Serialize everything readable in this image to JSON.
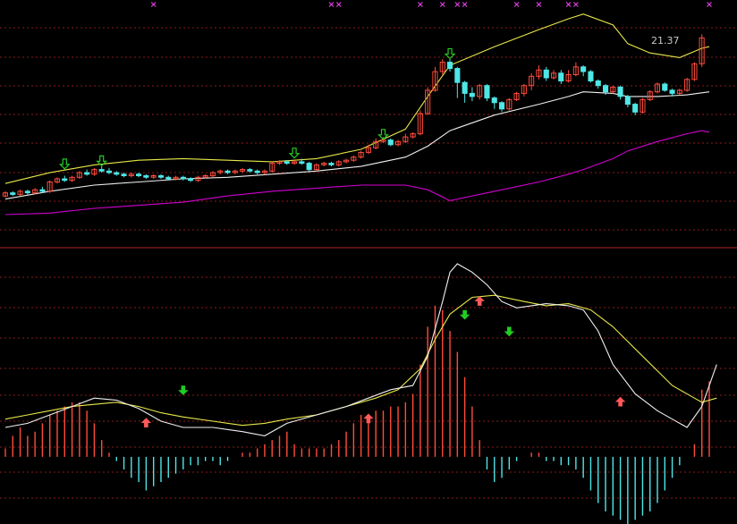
{
  "colors": {
    "background": "#000000",
    "grid": "#8b1a1a",
    "divider": "#b22222",
    "up_candle": "#ff4c3b",
    "down_candle": "#4fe6e6",
    "upper_band": "#e8e84a",
    "middle_band": "#f0f0f0",
    "lower_band": "#d000d0",
    "marker_x": "#e040e0",
    "signal_arrow": "#22cc22",
    "buy_arrow": "#ff5a5a",
    "macd_line": "#f0f0f0",
    "signal_line": "#e8e84a",
    "hist_pos": "#ff4c3b",
    "hist_neg": "#4fe6e6"
  },
  "chart_data": [
    {
      "type": "candlestick",
      "panel": "price",
      "price_label": "21.37",
      "ylim": [
        10,
        23
      ],
      "grid": true,
      "x_count": 96,
      "candles": [
        [
          0,
          11.2,
          11.4,
          11.5,
          11.1
        ],
        [
          1,
          11.4,
          11.3,
          11.5,
          11.2
        ],
        [
          2,
          11.3,
          11.5,
          11.6,
          11.2
        ],
        [
          3,
          11.5,
          11.4,
          11.6,
          11.3
        ],
        [
          4,
          11.4,
          11.6,
          11.7,
          11.3
        ],
        [
          5,
          11.6,
          11.5,
          11.8,
          11.4
        ],
        [
          6,
          11.5,
          12.1,
          12.2,
          11.4
        ],
        [
          7,
          12.1,
          12.3,
          12.4,
          12.0
        ],
        [
          8,
          12.3,
          12.2,
          12.5,
          12.1
        ],
        [
          9,
          12.2,
          12.4,
          12.5,
          12.1
        ],
        [
          10,
          12.4,
          12.7,
          12.8,
          12.3
        ],
        [
          11,
          12.7,
          12.6,
          12.9,
          12.5
        ],
        [
          12,
          12.6,
          12.9,
          13.0,
          12.5
        ],
        [
          13,
          12.9,
          12.8,
          13.1,
          12.7
        ],
        [
          14,
          12.8,
          12.7,
          13.0,
          12.6
        ],
        [
          15,
          12.7,
          12.6,
          12.8,
          12.5
        ],
        [
          16,
          12.6,
          12.5,
          12.7,
          12.4
        ],
        [
          17,
          12.5,
          12.6,
          12.7,
          12.4
        ],
        [
          18,
          12.6,
          12.5,
          12.7,
          12.4
        ],
        [
          19,
          12.5,
          12.4,
          12.6,
          12.3
        ],
        [
          20,
          12.4,
          12.5,
          12.6,
          12.3
        ],
        [
          21,
          12.5,
          12.4,
          12.6,
          12.3
        ],
        [
          22,
          12.4,
          12.3,
          12.5,
          12.2
        ],
        [
          23,
          12.3,
          12.4,
          12.5,
          12.2
        ],
        [
          24,
          12.4,
          12.3,
          12.5,
          12.2
        ],
        [
          25,
          12.3,
          12.2,
          12.4,
          12.1
        ],
        [
          26,
          12.2,
          12.4,
          12.5,
          12.1
        ],
        [
          27,
          12.4,
          12.5,
          12.6,
          12.3
        ],
        [
          28,
          12.5,
          12.7,
          12.8,
          12.4
        ],
        [
          29,
          12.7,
          12.8,
          12.9,
          12.6
        ],
        [
          30,
          12.8,
          12.7,
          12.9,
          12.6
        ],
        [
          31,
          12.7,
          12.8,
          12.9,
          12.6
        ],
        [
          32,
          12.8,
          12.9,
          13.0,
          12.7
        ],
        [
          33,
          12.9,
          12.8,
          13.0,
          12.7
        ],
        [
          34,
          12.8,
          12.7,
          12.9,
          12.6
        ],
        [
          35,
          12.7,
          12.8,
          12.9,
          12.6
        ],
        [
          36,
          12.8,
          13.3,
          13.4,
          12.7
        ],
        [
          37,
          13.3,
          13.4,
          13.5,
          13.2
        ],
        [
          38,
          13.4,
          13.3,
          13.5,
          13.2
        ],
        [
          39,
          13.3,
          13.4,
          13.5,
          13.2
        ],
        [
          40,
          13.4,
          13.3,
          13.6,
          13.2
        ],
        [
          41,
          13.3,
          12.9,
          13.4,
          12.8
        ],
        [
          42,
          12.9,
          13.2,
          13.3,
          12.8
        ],
        [
          43,
          13.2,
          13.3,
          13.4,
          13.1
        ],
        [
          44,
          13.3,
          13.2,
          13.4,
          13.1
        ],
        [
          45,
          13.2,
          13.4,
          13.5,
          13.1
        ],
        [
          46,
          13.4,
          13.5,
          13.6,
          13.3
        ],
        [
          47,
          13.5,
          13.7,
          13.8,
          13.4
        ],
        [
          48,
          13.7,
          14.0,
          14.1,
          13.6
        ],
        [
          49,
          14.0,
          14.3,
          14.5,
          13.9
        ],
        [
          50,
          14.3,
          14.7,
          14.9,
          14.2
        ],
        [
          51,
          14.7,
          14.8,
          15.0,
          14.6
        ],
        [
          52,
          14.8,
          14.5,
          14.9,
          14.4
        ],
        [
          53,
          14.5,
          14.7,
          14.8,
          14.4
        ],
        [
          54,
          14.7,
          15.0,
          15.2,
          14.6
        ],
        [
          55,
          15.0,
          15.2,
          15.3,
          14.9
        ],
        [
          56,
          15.2,
          16.5,
          16.7,
          15.1
        ],
        [
          57,
          16.5,
          18.0,
          18.2,
          16.4
        ],
        [
          58,
          18.0,
          19.2,
          19.5,
          17.9
        ],
        [
          59,
          19.2,
          19.8,
          20.0,
          19.0
        ],
        [
          60,
          19.8,
          19.4,
          20.0,
          19.2
        ],
        [
          61,
          19.4,
          18.5,
          19.5,
          17.5
        ],
        [
          62,
          18.5,
          17.8,
          18.6,
          17.2
        ],
        [
          63,
          17.8,
          17.6,
          18.2,
          17.3
        ],
        [
          64,
          17.6,
          18.3,
          18.4,
          17.4
        ],
        [
          65,
          18.3,
          17.5,
          18.4,
          17.3
        ],
        [
          66,
          17.5,
          17.2,
          17.6,
          16.8
        ],
        [
          67,
          17.2,
          16.8,
          17.3,
          16.6
        ],
        [
          68,
          16.8,
          17.4,
          17.5,
          16.7
        ],
        [
          69,
          17.4,
          17.8,
          17.9,
          17.3
        ],
        [
          70,
          17.8,
          18.3,
          18.4,
          17.6
        ],
        [
          71,
          18.3,
          18.9,
          19.1,
          18.0
        ],
        [
          72,
          18.9,
          19.3,
          19.6,
          18.7
        ],
        [
          73,
          19.3,
          18.8,
          19.5,
          18.6
        ],
        [
          74,
          18.8,
          19.1,
          19.3,
          18.7
        ],
        [
          75,
          19.1,
          18.6,
          19.3,
          18.4
        ],
        [
          76,
          18.6,
          19.0,
          19.3,
          18.5
        ],
        [
          77,
          19.0,
          19.5,
          19.8,
          18.9
        ],
        [
          78,
          19.5,
          19.2,
          19.6,
          18.9
        ],
        [
          79,
          19.2,
          18.6,
          19.3,
          18.5
        ],
        [
          80,
          18.6,
          18.3,
          18.7,
          18.1
        ],
        [
          81,
          18.3,
          17.9,
          18.4,
          17.7
        ],
        [
          82,
          17.9,
          18.2,
          18.3,
          17.8
        ],
        [
          83,
          18.2,
          17.6,
          18.3,
          17.4
        ],
        [
          84,
          17.6,
          17.1,
          17.7,
          16.9
        ],
        [
          85,
          17.1,
          16.6,
          17.2,
          16.4
        ],
        [
          86,
          16.6,
          17.4,
          17.5,
          16.5
        ],
        [
          87,
          17.4,
          17.9,
          18.0,
          17.3
        ],
        [
          88,
          17.9,
          18.4,
          18.5,
          17.8
        ],
        [
          89,
          18.4,
          18.0,
          18.5,
          17.9
        ],
        [
          90,
          18.0,
          17.8,
          18.1,
          17.6
        ],
        [
          91,
          17.8,
          18.0,
          18.1,
          17.7
        ],
        [
          92,
          18.0,
          18.7,
          18.8,
          17.9
        ],
        [
          93,
          18.7,
          19.7,
          19.8,
          18.6
        ],
        [
          94,
          19.7,
          21.37,
          21.6,
          19.5
        ]
      ],
      "upper_band": [
        [
          0,
          12.0
        ],
        [
          6,
          12.7
        ],
        [
          12,
          13.2
        ],
        [
          18,
          13.5
        ],
        [
          24,
          13.6
        ],
        [
          30,
          13.5
        ],
        [
          36,
          13.4
        ],
        [
          42,
          13.6
        ],
        [
          48,
          14.2
        ],
        [
          54,
          15.5
        ],
        [
          57,
          17.6
        ],
        [
          60,
          19.6
        ],
        [
          66,
          20.8
        ],
        [
          72,
          21.9
        ],
        [
          76,
          22.6
        ],
        [
          78,
          22.9
        ],
        [
          82,
          22.2
        ],
        [
          84,
          21.0
        ],
        [
          87,
          20.4
        ],
        [
          91,
          20.1
        ],
        [
          94,
          20.7
        ],
        [
          95,
          20.8
        ]
      ],
      "middle_band": [
        [
          0,
          11.0
        ],
        [
          6,
          11.5
        ],
        [
          12,
          11.9
        ],
        [
          18,
          12.1
        ],
        [
          24,
          12.3
        ],
        [
          30,
          12.4
        ],
        [
          36,
          12.6
        ],
        [
          42,
          12.8
        ],
        [
          48,
          13.1
        ],
        [
          54,
          13.7
        ],
        [
          57,
          14.4
        ],
        [
          60,
          15.4
        ],
        [
          66,
          16.4
        ],
        [
          72,
          17.1
        ],
        [
          76,
          17.6
        ],
        [
          78,
          17.9
        ],
        [
          82,
          17.8
        ],
        [
          84,
          17.6
        ],
        [
          88,
          17.6
        ],
        [
          92,
          17.7
        ],
        [
          95,
          17.9
        ]
      ],
      "lower_band": [
        [
          0,
          10.0
        ],
        [
          6,
          10.1
        ],
        [
          12,
          10.4
        ],
        [
          18,
          10.6
        ],
        [
          24,
          10.8
        ],
        [
          30,
          11.2
        ],
        [
          36,
          11.5
        ],
        [
          42,
          11.7
        ],
        [
          48,
          11.9
        ],
        [
          54,
          11.9
        ],
        [
          57,
          11.6
        ],
        [
          60,
          10.9
        ],
        [
          66,
          11.5
        ],
        [
          72,
          12.1
        ],
        [
          76,
          12.6
        ],
        [
          78,
          12.9
        ],
        [
          82,
          13.6
        ],
        [
          84,
          14.1
        ],
        [
          88,
          14.7
        ],
        [
          92,
          15.2
        ],
        [
          94,
          15.4
        ],
        [
          95,
          15.3
        ]
      ],
      "down_arrows": [
        [
          8,
          13.0
        ],
        [
          13,
          13.2
        ],
        [
          39,
          13.7
        ],
        [
          51,
          14.9
        ],
        [
          60,
          20.1
        ]
      ],
      "top_markers": [
        20,
        44,
        45,
        56,
        59,
        61,
        62,
        69,
        72,
        76,
        77,
        95
      ]
    },
    {
      "type": "histogram+line",
      "panel": "oscillator",
      "ylim": [
        -1.6,
        4.6
      ],
      "grid": true,
      "x_count": 96,
      "histogram": [
        0.2,
        0.5,
        0.7,
        0.5,
        0.6,
        0.8,
        1.0,
        1.1,
        1.2,
        1.3,
        1.3,
        1.1,
        0.8,
        0.4,
        0.1,
        -0.1,
        -0.3,
        -0.5,
        -0.6,
        -0.8,
        -0.7,
        -0.6,
        -0.5,
        -0.4,
        -0.3,
        -0.2,
        -0.2,
        -0.1,
        -0.1,
        -0.2,
        -0.1,
        0.0,
        0.1,
        0.1,
        0.2,
        0.3,
        0.4,
        0.5,
        0.6,
        0.3,
        0.2,
        0.2,
        0.2,
        0.2,
        0.3,
        0.4,
        0.6,
        0.8,
        1.0,
        1.0,
        1.1,
        1.1,
        1.2,
        1.2,
        1.3,
        1.5,
        2.2,
        3.1,
        3.6,
        3.5,
        3.0,
        2.5,
        1.9,
        1.2,
        0.4,
        -0.3,
        -0.6,
        -0.5,
        -0.3,
        -0.1,
        0.0,
        0.1,
        0.1,
        -0.1,
        -0.1,
        -0.2,
        -0.2,
        -0.3,
        -0.5,
        -0.8,
        -1.1,
        -1.3,
        -1.4,
        -1.5,
        -1.6,
        -1.5,
        -1.4,
        -1.3,
        -1.1,
        -0.8,
        -0.5,
        -0.2,
        0.0,
        0.3,
        1.6,
        1.8
      ],
      "macd_line": [
        [
          0,
          0.7
        ],
        [
          3,
          0.8
        ],
        [
          6,
          1.0
        ],
        [
          9,
          1.2
        ],
        [
          12,
          1.4
        ],
        [
          15,
          1.35
        ],
        [
          18,
          1.15
        ],
        [
          21,
          0.85
        ],
        [
          24,
          0.7
        ],
        [
          28,
          0.7
        ],
        [
          32,
          0.6
        ],
        [
          35,
          0.5
        ],
        [
          38,
          0.8
        ],
        [
          42,
          1.0
        ],
        [
          46,
          1.2
        ],
        [
          49,
          1.4
        ],
        [
          52,
          1.6
        ],
        [
          55,
          1.7
        ],
        [
          57,
          2.4
        ],
        [
          59,
          3.7
        ],
        [
          60,
          4.4
        ],
        [
          61,
          4.6
        ],
        [
          63,
          4.4
        ],
        [
          65,
          4.1
        ],
        [
          67,
          3.7
        ],
        [
          69,
          3.55
        ],
        [
          71,
          3.6
        ],
        [
          73,
          3.65
        ],
        [
          76,
          3.6
        ],
        [
          78,
          3.5
        ],
        [
          80,
          3.0
        ],
        [
          82,
          2.2
        ],
        [
          85,
          1.5
        ],
        [
          88,
          1.1
        ],
        [
          90,
          0.9
        ],
        [
          92,
          0.7
        ],
        [
          94,
          1.2
        ],
        [
          96,
          2.2
        ]
      ],
      "signal_line": [
        [
          0,
          0.9
        ],
        [
          3,
          1.0
        ],
        [
          6,
          1.1
        ],
        [
          9,
          1.2
        ],
        [
          12,
          1.25
        ],
        [
          15,
          1.3
        ],
        [
          18,
          1.2
        ],
        [
          21,
          1.05
        ],
        [
          24,
          0.95
        ],
        [
          28,
          0.85
        ],
        [
          32,
          0.75
        ],
        [
          35,
          0.8
        ],
        [
          38,
          0.9
        ],
        [
          42,
          1.0
        ],
        [
          46,
          1.2
        ],
        [
          50,
          1.4
        ],
        [
          53,
          1.6
        ],
        [
          56,
          2.1
        ],
        [
          58,
          2.8
        ],
        [
          60,
          3.4
        ],
        [
          63,
          3.8
        ],
        [
          66,
          3.85
        ],
        [
          70,
          3.7
        ],
        [
          73,
          3.6
        ],
        [
          76,
          3.65
        ],
        [
          79,
          3.5
        ],
        [
          82,
          3.1
        ],
        [
          86,
          2.4
        ],
        [
          90,
          1.7
        ],
        [
          93,
          1.4
        ],
        [
          94,
          1.3
        ],
        [
          96,
          1.4
        ]
      ],
      "buy_arrows": [
        [
          19,
          0.9
        ],
        [
          49,
          1.0
        ],
        [
          64,
          3.8
        ],
        [
          83,
          1.4
        ]
      ],
      "sell_arrows": [
        [
          24,
          1.5
        ],
        [
          62,
          3.3
        ],
        [
          68,
          2.9
        ]
      ]
    }
  ]
}
